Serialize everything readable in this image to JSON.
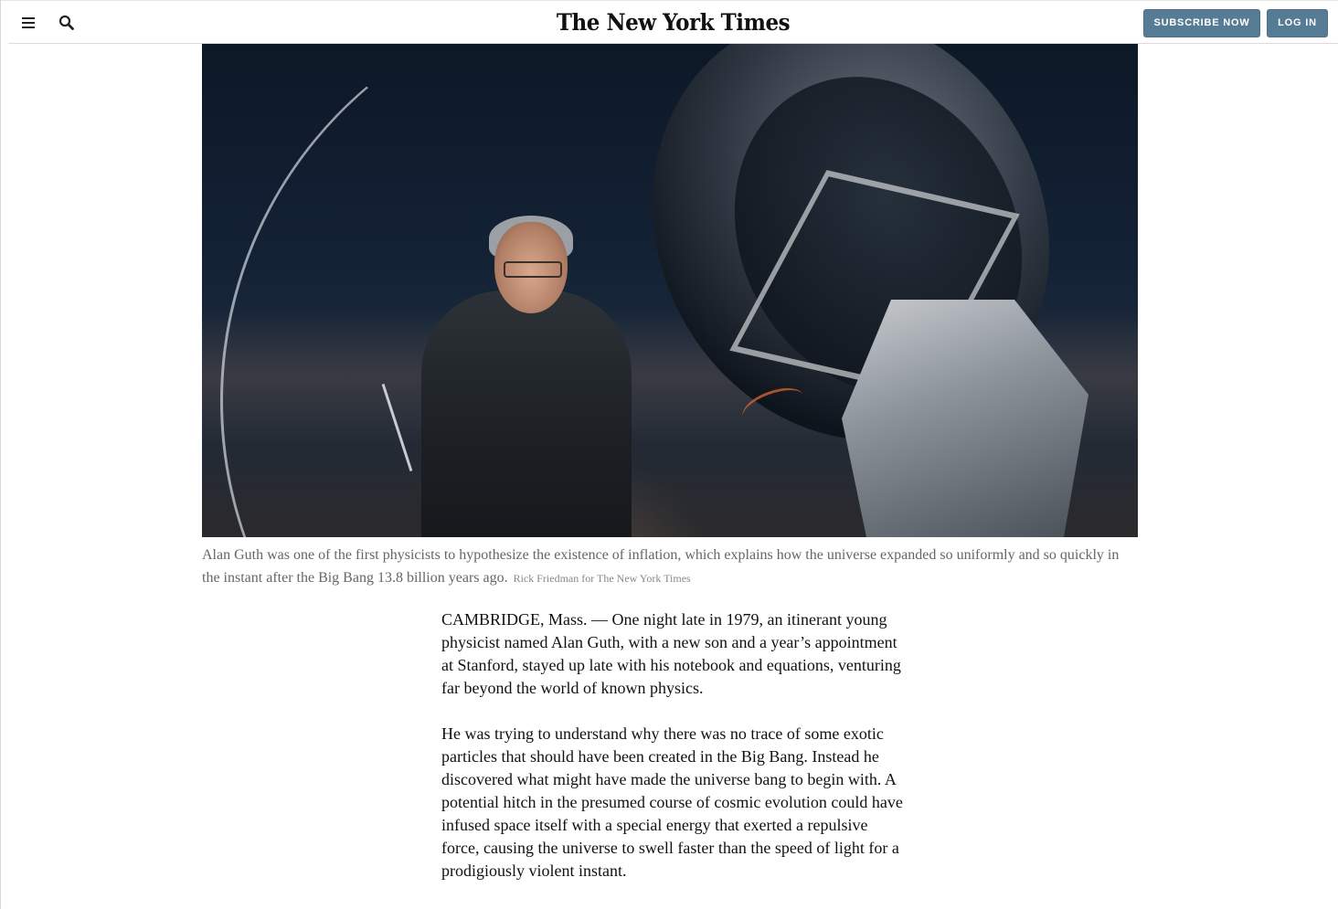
{
  "header": {
    "logo": "The New York Times",
    "subscribe_label": "SUBSCRIBE NOW",
    "login_label": "LOG IN",
    "accent_color": "#567b95"
  },
  "icons": {
    "menu": "hamburger-menu-icon",
    "search": "search-icon"
  },
  "photo": {
    "caption": "Alan Guth was one of the first physicists to hypothesize the existence of inflation, which explains how the universe expanded so uniformly and so quickly in the instant after the Big Bang 13.8 billion years ago.",
    "credit": "Rick Friedman for The New York Times"
  },
  "article": {
    "paragraphs": [
      "CAMBRIDGE, Mass. — One night late in 1979, an itinerant young physicist named Alan Guth, with a new son and a year’s appointment at Stanford, stayed up late with his notebook and equations, venturing far beyond the world of known physics.",
      "He was trying to understand why there was no trace of some exotic particles that should have been created in the Big Bang. Instead he discovered what might have made the universe bang to begin with. A potential hitch in the presumed course of cosmic evolution could have infused space itself with a special energy that exerted a repulsive force, causing the universe to swell faster than the speed of light for a prodigiously violent instant."
    ]
  }
}
